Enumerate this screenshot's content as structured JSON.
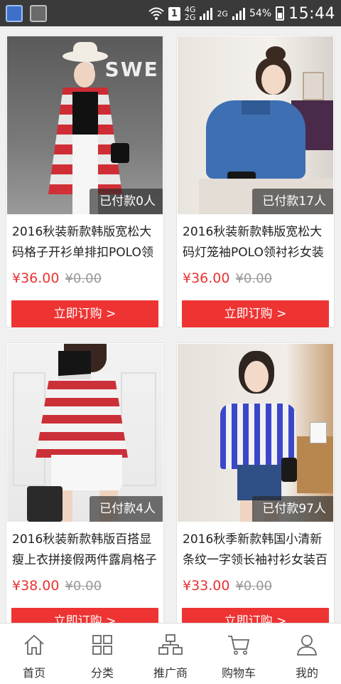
{
  "status_bar": {
    "time": "15:44",
    "battery": "54%",
    "sim_slot": "1",
    "net_4g": "4G",
    "net_2g_a": "2G",
    "net_2g_b": "2G"
  },
  "products": [
    {
      "paid": "已付款0人",
      "title": "2016秋装新款韩版宽松大码格子开衫单排扣POLO领",
      "price": "¥36.00",
      "old_price": "¥0.00",
      "buy_label": "立即订购 >",
      "photo_text": "O SWE"
    },
    {
      "paid": "已付款17人",
      "title": "2016秋装新款韩版宽松大码灯笼袖POLO领衬衫女装",
      "price": "¥36.00",
      "old_price": "¥0.00",
      "buy_label": "立即订购 >"
    },
    {
      "paid": "已付款4人",
      "title": "2016秋装新款韩版百搭显瘦上衣拼接假两件露肩格子",
      "price": "¥38.00",
      "old_price": "¥0.00",
      "buy_label": "立即订购 >"
    },
    {
      "paid": "已付款97人",
      "title": "2016秋季新款韩国小清新条纹一字领长袖衬衫女装百",
      "price": "¥33.00",
      "old_price": "¥0.00",
      "buy_label": "立即订购 >"
    }
  ],
  "tabs": [
    {
      "label": "首页",
      "icon": "home-icon"
    },
    {
      "label": "分类",
      "icon": "grid-icon"
    },
    {
      "label": "推广商",
      "icon": "org-chart-icon"
    },
    {
      "label": "购物车",
      "icon": "cart-icon"
    },
    {
      "label": "我的",
      "icon": "user-icon"
    }
  ],
  "colors": {
    "accent": "#ee3333",
    "price": "#e83333",
    "status_bar": "#3a3a3a"
  }
}
